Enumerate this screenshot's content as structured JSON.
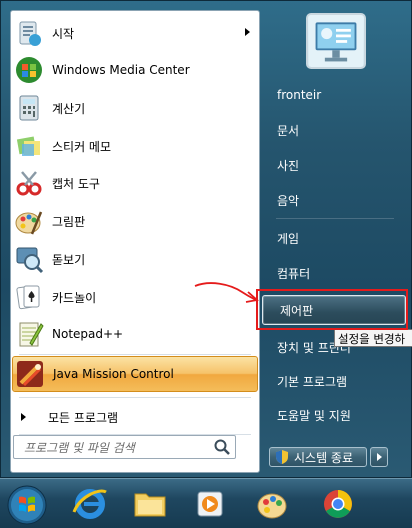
{
  "programs": [
    {
      "label": "시작",
      "icon": "getting-started-icon",
      "has_submenu": true
    },
    {
      "label": "Windows Media Center",
      "icon": "media-center-icon"
    },
    {
      "label": "계산기",
      "icon": "calculator-icon"
    },
    {
      "label": "스티커 메모",
      "icon": "sticky-notes-icon"
    },
    {
      "label": "캡처 도구",
      "icon": "snipping-tool-icon"
    },
    {
      "label": "그림판",
      "icon": "paint-icon"
    },
    {
      "label": "돋보기",
      "icon": "magnifier-icon"
    },
    {
      "label": "카드놀이",
      "icon": "solitaire-icon"
    },
    {
      "label": "Notepad++",
      "icon": "notepad-plus-icon"
    },
    {
      "label": "Java Mission Control",
      "icon": "java-mission-control-icon",
      "selected": true
    }
  ],
  "all_programs": "모든 프로그램",
  "search": {
    "placeholder": "프로그램 및 파일 검색"
  },
  "right_links": [
    {
      "label": "fronteir"
    },
    {
      "label": "문서"
    },
    {
      "label": "사진"
    },
    {
      "label": "음악"
    },
    {
      "label": "게임"
    },
    {
      "label": "컴퓨터"
    },
    {
      "label": "제어판",
      "highlighted": true
    },
    {
      "label": "장치 및 프린터"
    },
    {
      "label": "기본 프로그램"
    },
    {
      "label": "도움말 및 지원"
    }
  ],
  "tooltip": "설정을 변경하",
  "shutdown_label": "시스템 종료",
  "taskbar": [
    "start-orb",
    "internet-explorer-icon",
    "file-explorer-icon",
    "media-player-icon",
    "paint-palette-icon",
    "chrome-icon"
  ],
  "colors": {
    "highlight": "#f4bd5a",
    "annotation": "#e51b1b",
    "menu_blue": "#25556e"
  }
}
